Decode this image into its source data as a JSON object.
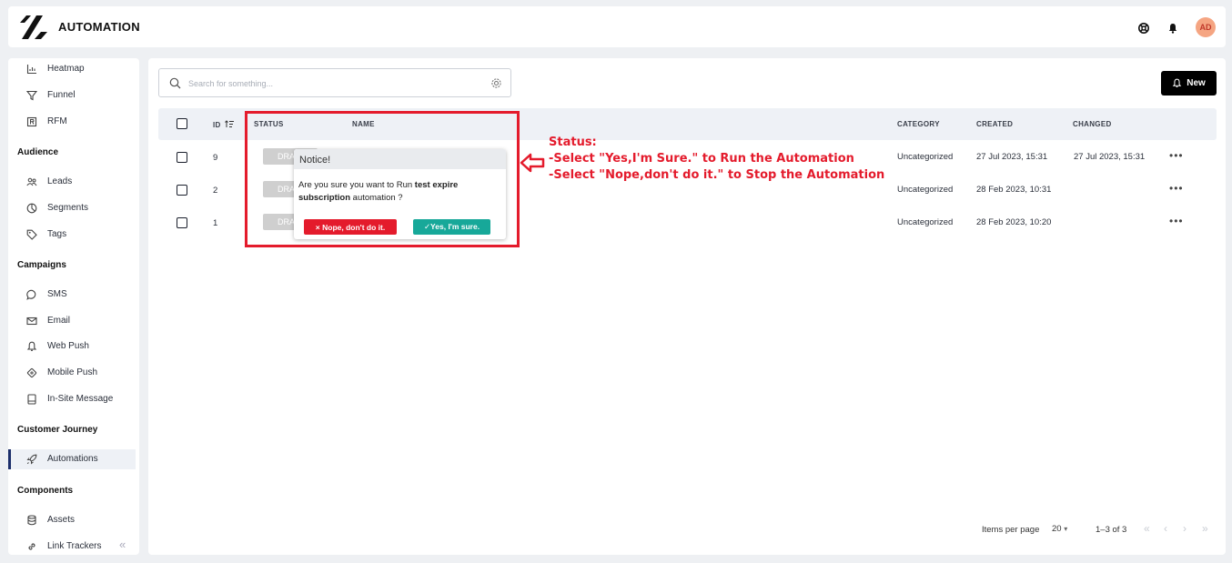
{
  "header": {
    "title": "AUTOMATION",
    "avatar": "AD",
    "icons": [
      "support-icon",
      "bell-icon"
    ]
  },
  "sidebar": {
    "items_top": [
      {
        "label": "Heatmap",
        "icon": "heatmap-icon"
      },
      {
        "label": "Funnel",
        "icon": "funnel-icon"
      },
      {
        "label": "RFM",
        "icon": "rfm-icon"
      }
    ],
    "sections": [
      {
        "title": "Audience",
        "items": [
          {
            "label": "Leads",
            "icon": "users-icon"
          },
          {
            "label": "Segments",
            "icon": "pie-icon"
          },
          {
            "label": "Tags",
            "icon": "tag-icon"
          }
        ]
      },
      {
        "title": "Campaigns",
        "items": [
          {
            "label": "SMS",
            "icon": "chat-icon"
          },
          {
            "label": "Email",
            "icon": "mail-icon"
          },
          {
            "label": "Web Push",
            "icon": "bell-icon"
          },
          {
            "label": "Mobile Push",
            "icon": "mobile-icon"
          },
          {
            "label": "In-Site Message",
            "icon": "message-icon"
          }
        ]
      },
      {
        "title": "Customer Journey",
        "items": [
          {
            "label": "Automations",
            "icon": "rocket-icon",
            "active": true
          }
        ]
      },
      {
        "title": "Components",
        "items": [
          {
            "label": "Assets",
            "icon": "database-icon"
          },
          {
            "label": "Link Trackers",
            "icon": "link-icon"
          }
        ]
      }
    ]
  },
  "toolbar": {
    "search_placeholder": "Search for something...",
    "new_label": "New"
  },
  "table": {
    "columns": {
      "id": "ID",
      "status": "STATUS",
      "name": "NAME",
      "category": "CATEGORY",
      "created": "CREATED",
      "changed": "CHANGED"
    },
    "rows": [
      {
        "id": "9",
        "status": "DRA",
        "category": "Uncategorized",
        "created": "27 Jul 2023, 15:31",
        "changed": "27 Jul 2023, 15:31"
      },
      {
        "id": "2",
        "status": "DRA",
        "category": "Uncategorized",
        "created": "28 Feb 2023, 10:31",
        "changed": ""
      },
      {
        "id": "1",
        "status": "DRA",
        "category": "Uncategorized",
        "created": "28 Feb 2023, 10:20",
        "changed": ""
      }
    ],
    "row_menu": "•••"
  },
  "popup": {
    "title": "Notice!",
    "text_before": "Are you sure you want to Run ",
    "text_bold": "test expire subscription",
    "text_after": " automation ?",
    "nope_label": "× Nope, don't do it.",
    "yes_label": "✓Yes, I'm sure."
  },
  "annotation": {
    "line1": "Status:",
    "line2": "-Select \"Yes,I'm Sure.\" to Run the Automation",
    "line3": "-Select \"Nope,don't do it.\" to Stop the Automation",
    "color": "#e41b2c"
  },
  "pagination": {
    "items_per_page_label": "Items per page",
    "items_per_page": "20",
    "range": "1–3 of 3"
  }
}
